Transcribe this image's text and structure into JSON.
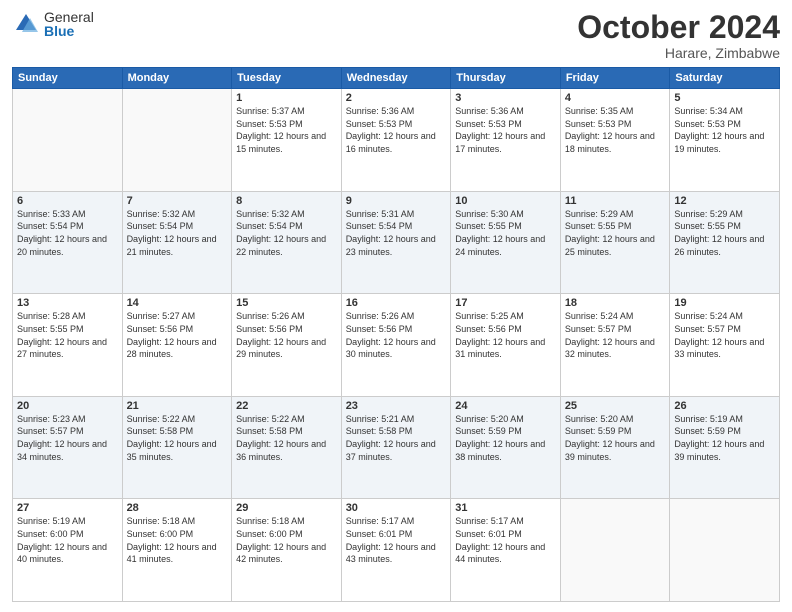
{
  "header": {
    "logo_general": "General",
    "logo_blue": "Blue",
    "month_title": "October 2024",
    "location": "Harare, Zimbabwe"
  },
  "days_of_week": [
    "Sunday",
    "Monday",
    "Tuesday",
    "Wednesday",
    "Thursday",
    "Friday",
    "Saturday"
  ],
  "weeks": [
    [
      {
        "day": "",
        "info": ""
      },
      {
        "day": "",
        "info": ""
      },
      {
        "day": "1",
        "info": "Sunrise: 5:37 AM\nSunset: 5:53 PM\nDaylight: 12 hours and 15 minutes."
      },
      {
        "day": "2",
        "info": "Sunrise: 5:36 AM\nSunset: 5:53 PM\nDaylight: 12 hours and 16 minutes."
      },
      {
        "day": "3",
        "info": "Sunrise: 5:36 AM\nSunset: 5:53 PM\nDaylight: 12 hours and 17 minutes."
      },
      {
        "day": "4",
        "info": "Sunrise: 5:35 AM\nSunset: 5:53 PM\nDaylight: 12 hours and 18 minutes."
      },
      {
        "day": "5",
        "info": "Sunrise: 5:34 AM\nSunset: 5:53 PM\nDaylight: 12 hours and 19 minutes."
      }
    ],
    [
      {
        "day": "6",
        "info": "Sunrise: 5:33 AM\nSunset: 5:54 PM\nDaylight: 12 hours and 20 minutes."
      },
      {
        "day": "7",
        "info": "Sunrise: 5:32 AM\nSunset: 5:54 PM\nDaylight: 12 hours and 21 minutes."
      },
      {
        "day": "8",
        "info": "Sunrise: 5:32 AM\nSunset: 5:54 PM\nDaylight: 12 hours and 22 minutes."
      },
      {
        "day": "9",
        "info": "Sunrise: 5:31 AM\nSunset: 5:54 PM\nDaylight: 12 hours and 23 minutes."
      },
      {
        "day": "10",
        "info": "Sunrise: 5:30 AM\nSunset: 5:55 PM\nDaylight: 12 hours and 24 minutes."
      },
      {
        "day": "11",
        "info": "Sunrise: 5:29 AM\nSunset: 5:55 PM\nDaylight: 12 hours and 25 minutes."
      },
      {
        "day": "12",
        "info": "Sunrise: 5:29 AM\nSunset: 5:55 PM\nDaylight: 12 hours and 26 minutes."
      }
    ],
    [
      {
        "day": "13",
        "info": "Sunrise: 5:28 AM\nSunset: 5:55 PM\nDaylight: 12 hours and 27 minutes."
      },
      {
        "day": "14",
        "info": "Sunrise: 5:27 AM\nSunset: 5:56 PM\nDaylight: 12 hours and 28 minutes."
      },
      {
        "day": "15",
        "info": "Sunrise: 5:26 AM\nSunset: 5:56 PM\nDaylight: 12 hours and 29 minutes."
      },
      {
        "day": "16",
        "info": "Sunrise: 5:26 AM\nSunset: 5:56 PM\nDaylight: 12 hours and 30 minutes."
      },
      {
        "day": "17",
        "info": "Sunrise: 5:25 AM\nSunset: 5:56 PM\nDaylight: 12 hours and 31 minutes."
      },
      {
        "day": "18",
        "info": "Sunrise: 5:24 AM\nSunset: 5:57 PM\nDaylight: 12 hours and 32 minutes."
      },
      {
        "day": "19",
        "info": "Sunrise: 5:24 AM\nSunset: 5:57 PM\nDaylight: 12 hours and 33 minutes."
      }
    ],
    [
      {
        "day": "20",
        "info": "Sunrise: 5:23 AM\nSunset: 5:57 PM\nDaylight: 12 hours and 34 minutes."
      },
      {
        "day": "21",
        "info": "Sunrise: 5:22 AM\nSunset: 5:58 PM\nDaylight: 12 hours and 35 minutes."
      },
      {
        "day": "22",
        "info": "Sunrise: 5:22 AM\nSunset: 5:58 PM\nDaylight: 12 hours and 36 minutes."
      },
      {
        "day": "23",
        "info": "Sunrise: 5:21 AM\nSunset: 5:58 PM\nDaylight: 12 hours and 37 minutes."
      },
      {
        "day": "24",
        "info": "Sunrise: 5:20 AM\nSunset: 5:59 PM\nDaylight: 12 hours and 38 minutes."
      },
      {
        "day": "25",
        "info": "Sunrise: 5:20 AM\nSunset: 5:59 PM\nDaylight: 12 hours and 39 minutes."
      },
      {
        "day": "26",
        "info": "Sunrise: 5:19 AM\nSunset: 5:59 PM\nDaylight: 12 hours and 39 minutes."
      }
    ],
    [
      {
        "day": "27",
        "info": "Sunrise: 5:19 AM\nSunset: 6:00 PM\nDaylight: 12 hours and 40 minutes."
      },
      {
        "day": "28",
        "info": "Sunrise: 5:18 AM\nSunset: 6:00 PM\nDaylight: 12 hours and 41 minutes."
      },
      {
        "day": "29",
        "info": "Sunrise: 5:18 AM\nSunset: 6:00 PM\nDaylight: 12 hours and 42 minutes."
      },
      {
        "day": "30",
        "info": "Sunrise: 5:17 AM\nSunset: 6:01 PM\nDaylight: 12 hours and 43 minutes."
      },
      {
        "day": "31",
        "info": "Sunrise: 5:17 AM\nSunset: 6:01 PM\nDaylight: 12 hours and 44 minutes."
      },
      {
        "day": "",
        "info": ""
      },
      {
        "day": "",
        "info": ""
      }
    ]
  ],
  "colors": {
    "header_bg": "#2a6ab5",
    "header_text": "#ffffff",
    "accent": "#1a6fb5"
  }
}
